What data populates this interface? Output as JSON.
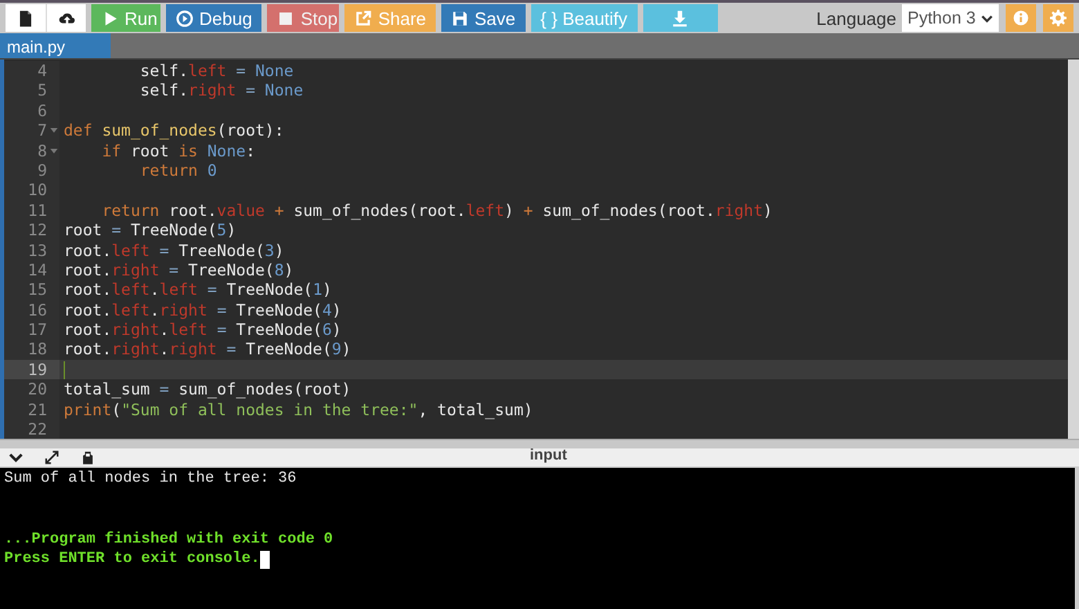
{
  "toolbar": {
    "buttons": [
      {
        "kind": "new-file",
        "disabled": false
      },
      {
        "kind": "upload",
        "disabled": false
      },
      {
        "kind": "run",
        "label": "Run",
        "disabled": false
      },
      {
        "kind": "debug",
        "label": "Debug",
        "disabled": false
      },
      {
        "kind": "stop",
        "label": "Stop",
        "disabled": true
      },
      {
        "kind": "share",
        "label": "Share",
        "disabled": false
      },
      {
        "kind": "save",
        "label": "Save",
        "disabled": false
      },
      {
        "kind": "beautify",
        "label": "{ } Beautify",
        "disabled": false
      },
      {
        "kind": "download",
        "disabled": false
      }
    ],
    "language": {
      "label": "Language",
      "value": "Python 3"
    },
    "right_buttons": [
      {
        "kind": "info"
      },
      {
        "kind": "settings"
      }
    ]
  },
  "tabs": [
    {
      "label": "main.py",
      "selected": true
    }
  ],
  "editor": {
    "lines": [
      {
        "number": "4",
        "fold": false,
        "active": false,
        "tokens": [
          {
            "t": "        self.",
            "color": "#e8e8e8"
          },
          {
            "t": "left",
            "color": "#c0392b"
          },
          {
            "t": " = ",
            "color": "#7f9fbf"
          },
          {
            "t": "None",
            "color": "#6b9acb"
          }
        ]
      },
      {
        "number": "5",
        "fold": false,
        "active": false,
        "tokens": [
          {
            "t": "        self.",
            "color": "#e8e8e8"
          },
          {
            "t": "right",
            "color": "#c0392b"
          },
          {
            "t": " = ",
            "color": "#7f9fbf"
          },
          {
            "t": "None",
            "color": "#6b9acb"
          }
        ]
      },
      {
        "number": "6",
        "fold": false,
        "active": false
      },
      {
        "number": "7",
        "fold": true,
        "active": false,
        "tokens": [
          {
            "t": "def ",
            "color": "#cf7a3a"
          },
          {
            "t": "sum_of_nodes",
            "color": "#e8c66a"
          },
          {
            "t": "(root):",
            "color": "#e8e8e8"
          }
        ]
      },
      {
        "number": "8",
        "fold": true,
        "active": false,
        "tokens": [
          {
            "t": "    if ",
            "color": "#cf7a3a"
          },
          {
            "t": "root ",
            "color": "#e8e8e8"
          },
          {
            "t": "is ",
            "color": "#cf7a3a"
          },
          {
            "t": "None",
            "color": "#6b9acb"
          },
          {
            "t": ":",
            "color": "#e8e8e8"
          }
        ]
      },
      {
        "number": "9",
        "fold": false,
        "active": false,
        "tokens": [
          {
            "t": "        return ",
            "color": "#cf7a3a"
          },
          {
            "t": "0",
            "color": "#6b9acb"
          }
        ]
      },
      {
        "number": "10",
        "fold": false,
        "active": false
      },
      {
        "number": "11",
        "fold": false,
        "active": false,
        "tokens": [
          {
            "t": "    return ",
            "color": "#cf7a3a"
          },
          {
            "t": "root.",
            "color": "#e8e8e8"
          },
          {
            "t": "value",
            "color": "#c0392b"
          },
          {
            "t": " + ",
            "color": "#cf7a3a"
          },
          {
            "t": "sum_of_nodes(root.",
            "color": "#e8e8e8"
          },
          {
            "t": "left",
            "color": "#c0392b"
          },
          {
            "t": ") ",
            "color": "#e8e8e8"
          },
          {
            "t": "+ ",
            "color": "#cf7a3a"
          },
          {
            "t": "sum_of_nodes(root.",
            "color": "#e8e8e8"
          },
          {
            "t": "right",
            "color": "#c0392b"
          },
          {
            "t": ")",
            "color": "#e8e8e8"
          }
        ]
      },
      {
        "number": "12",
        "fold": false,
        "active": false,
        "tokens": [
          {
            "t": "root",
            "color": "#e8e8e8"
          },
          {
            "t": " = ",
            "color": "#7f9fbf"
          },
          {
            "t": "TreeNode(",
            "color": "#e8e8e8"
          },
          {
            "t": "5",
            "color": "#6b9acb"
          },
          {
            "t": ")",
            "color": "#e8e8e8"
          }
        ]
      },
      {
        "number": "13",
        "fold": false,
        "active": false,
        "tokens": [
          {
            "t": "root.",
            "color": "#e8e8e8"
          },
          {
            "t": "left",
            "color": "#c0392b"
          },
          {
            "t": " = ",
            "color": "#7f9fbf"
          },
          {
            "t": "TreeNode(",
            "color": "#e8e8e8"
          },
          {
            "t": "3",
            "color": "#6b9acb"
          },
          {
            "t": ")",
            "color": "#e8e8e8"
          }
        ]
      },
      {
        "number": "14",
        "fold": false,
        "active": false,
        "tokens": [
          {
            "t": "root.",
            "color": "#e8e8e8"
          },
          {
            "t": "right",
            "color": "#c0392b"
          },
          {
            "t": " = ",
            "color": "#7f9fbf"
          },
          {
            "t": "TreeNode(",
            "color": "#e8e8e8"
          },
          {
            "t": "8",
            "color": "#6b9acb"
          },
          {
            "t": ")",
            "color": "#e8e8e8"
          }
        ]
      },
      {
        "number": "15",
        "fold": false,
        "active": false,
        "tokens": [
          {
            "t": "root.",
            "color": "#e8e8e8"
          },
          {
            "t": "left",
            "color": "#c0392b"
          },
          {
            "t": ".",
            "color": "#e8e8e8"
          },
          {
            "t": "left",
            "color": "#c0392b"
          },
          {
            "t": " = ",
            "color": "#7f9fbf"
          },
          {
            "t": "TreeNode(",
            "color": "#e8e8e8"
          },
          {
            "t": "1",
            "color": "#6b9acb"
          },
          {
            "t": ")",
            "color": "#e8e8e8"
          }
        ]
      },
      {
        "number": "16",
        "fold": false,
        "active": false,
        "tokens": [
          {
            "t": "root.",
            "color": "#e8e8e8"
          },
          {
            "t": "left",
            "color": "#c0392b"
          },
          {
            "t": ".",
            "color": "#e8e8e8"
          },
          {
            "t": "right",
            "color": "#c0392b"
          },
          {
            "t": " = ",
            "color": "#7f9fbf"
          },
          {
            "t": "TreeNode(",
            "color": "#e8e8e8"
          },
          {
            "t": "4",
            "color": "#6b9acb"
          },
          {
            "t": ")",
            "color": "#e8e8e8"
          }
        ]
      },
      {
        "number": "17",
        "fold": false,
        "active": false,
        "tokens": [
          {
            "t": "root.",
            "color": "#e8e8e8"
          },
          {
            "t": "right",
            "color": "#c0392b"
          },
          {
            "t": ".",
            "color": "#e8e8e8"
          },
          {
            "t": "left",
            "color": "#c0392b"
          },
          {
            "t": " = ",
            "color": "#7f9fbf"
          },
          {
            "t": "TreeNode(",
            "color": "#e8e8e8"
          },
          {
            "t": "6",
            "color": "#6b9acb"
          },
          {
            "t": ")",
            "color": "#e8e8e8"
          }
        ]
      },
      {
        "number": "18",
        "fold": false,
        "active": false,
        "tokens": [
          {
            "t": "root.",
            "color": "#e8e8e8"
          },
          {
            "t": "right",
            "color": "#c0392b"
          },
          {
            "t": ".",
            "color": "#e8e8e8"
          },
          {
            "t": "right",
            "color": "#c0392b"
          },
          {
            "t": " = ",
            "color": "#7f9fbf"
          },
          {
            "t": "TreeNode(",
            "color": "#e8e8e8"
          },
          {
            "t": "9",
            "color": "#6b9acb"
          },
          {
            "t": ")",
            "color": "#e8e8e8"
          }
        ]
      },
      {
        "number": "19",
        "fold": false,
        "active": true
      },
      {
        "number": "20",
        "fold": false,
        "active": false,
        "tokens": [
          {
            "t": "total_sum",
            "color": "#e8e8e8"
          },
          {
            "t": " = ",
            "color": "#7f9fbf"
          },
          {
            "t": "sum_of_nodes(root)",
            "color": "#e8e8e8"
          }
        ]
      },
      {
        "number": "21",
        "fold": false,
        "active": false,
        "tokens": [
          {
            "t": "print",
            "color": "#cf7a3a"
          },
          {
            "t": "(",
            "color": "#e8e8e8"
          },
          {
            "t": "\"Sum of all nodes in the tree:\"",
            "color": "#8fbf5a"
          },
          {
            "t": ", total_sum)",
            "color": "#e8e8e8"
          }
        ]
      },
      {
        "number": "22",
        "fold": false,
        "active": false
      }
    ]
  },
  "console": {
    "header_icons": [
      {
        "kind": "collapse"
      },
      {
        "kind": "expand"
      },
      {
        "kind": "clear"
      }
    ],
    "title": "input",
    "output": [
      "Sum of all nodes in the tree: 36"
    ],
    "status": [
      "...Program finished with exit code 0",
      "Press ENTER to exit console."
    ],
    "cursor": true
  }
}
